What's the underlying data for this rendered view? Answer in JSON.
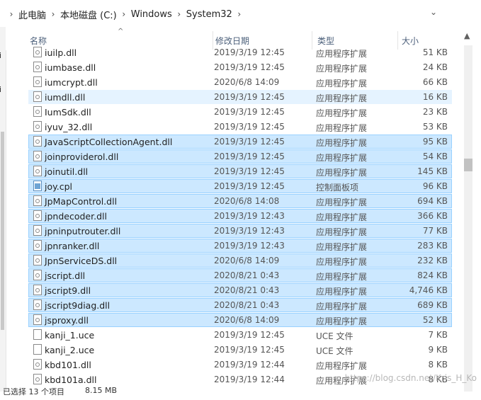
{
  "breadcrumb": {
    "items": [
      "此电脑",
      "本地磁盘 (C:)",
      "Windows",
      "System32"
    ]
  },
  "columns": {
    "name": "名称",
    "date": "修改日期",
    "type": "类型",
    "size": "大小"
  },
  "files": [
    {
      "name": "iuilp.dll",
      "date": "2019/3/19 12:45",
      "type": "应用程序扩展",
      "size": "51 KB",
      "icon": "dll-file-icon",
      "state": "normal"
    },
    {
      "name": "iumbase.dll",
      "date": "2019/3/19 12:45",
      "type": "应用程序扩展",
      "size": "24 KB",
      "icon": "dll-file-icon",
      "state": "normal"
    },
    {
      "name": "iumcrypt.dll",
      "date": "2020/6/8 14:09",
      "type": "应用程序扩展",
      "size": "66 KB",
      "icon": "dll-file-icon",
      "state": "normal"
    },
    {
      "name": "iumdll.dll",
      "date": "2019/3/19 12:45",
      "type": "应用程序扩展",
      "size": "16 KB",
      "icon": "dll-file-icon",
      "state": "hover"
    },
    {
      "name": "IumSdk.dll",
      "date": "2019/3/19 12:45",
      "type": "应用程序扩展",
      "size": "23 KB",
      "icon": "dll-file-icon",
      "state": "normal"
    },
    {
      "name": "iyuv_32.dll",
      "date": "2019/3/19 12:45",
      "type": "应用程序扩展",
      "size": "53 KB",
      "icon": "dll-file-icon",
      "state": "normal"
    },
    {
      "name": "JavaScriptCollectionAgent.dll",
      "date": "2019/3/19 12:45",
      "type": "应用程序扩展",
      "size": "95 KB",
      "icon": "dll-file-icon",
      "state": "selected"
    },
    {
      "name": "joinproviderol.dll",
      "date": "2019/3/19 12:45",
      "type": "应用程序扩展",
      "size": "54 KB",
      "icon": "dll-file-icon",
      "state": "selected"
    },
    {
      "name": "joinutil.dll",
      "date": "2019/3/19 12:45",
      "type": "应用程序扩展",
      "size": "145 KB",
      "icon": "dll-file-icon",
      "state": "selected"
    },
    {
      "name": "joy.cpl",
      "date": "2019/3/19 12:45",
      "type": "控制面板项",
      "size": "96 KB",
      "icon": "control-panel-icon",
      "state": "selected"
    },
    {
      "name": "JpMapControl.dll",
      "date": "2020/6/8 14:08",
      "type": "应用程序扩展",
      "size": "694 KB",
      "icon": "dll-file-icon",
      "state": "selected"
    },
    {
      "name": "jpndecoder.dll",
      "date": "2019/3/19 12:43",
      "type": "应用程序扩展",
      "size": "366 KB",
      "icon": "dll-file-icon",
      "state": "selected"
    },
    {
      "name": "jpninputrouter.dll",
      "date": "2019/3/19 12:43",
      "type": "应用程序扩展",
      "size": "77 KB",
      "icon": "dll-file-icon",
      "state": "selected"
    },
    {
      "name": "jpnranker.dll",
      "date": "2019/3/19 12:43",
      "type": "应用程序扩展",
      "size": "283 KB",
      "icon": "dll-file-icon",
      "state": "selected"
    },
    {
      "name": "JpnServiceDS.dll",
      "date": "2020/6/8 14:09",
      "type": "应用程序扩展",
      "size": "232 KB",
      "icon": "dll-file-icon",
      "state": "selected"
    },
    {
      "name": "jscript.dll",
      "date": "2020/8/21 0:43",
      "type": "应用程序扩展",
      "size": "824 KB",
      "icon": "dll-file-icon",
      "state": "selected"
    },
    {
      "name": "jscript9.dll",
      "date": "2020/8/21 0:43",
      "type": "应用程序扩展",
      "size": "4,746 KB",
      "icon": "dll-file-icon",
      "state": "selected"
    },
    {
      "name": "jscript9diag.dll",
      "date": "2020/8/21 0:43",
      "type": "应用程序扩展",
      "size": "689 KB",
      "icon": "dll-file-icon",
      "state": "selected"
    },
    {
      "name": "jsproxy.dll",
      "date": "2020/6/8 14:09",
      "type": "应用程序扩展",
      "size": "52 KB",
      "icon": "dll-file-icon",
      "state": "selected"
    },
    {
      "name": "kanji_1.uce",
      "date": "2019/3/19 12:45",
      "type": "UCE 文件",
      "size": "7 KB",
      "icon": "file-icon",
      "state": "normal"
    },
    {
      "name": "kanji_2.uce",
      "date": "2019/3/19 12:45",
      "type": "UCE 文件",
      "size": "9 KB",
      "icon": "file-icon",
      "state": "normal"
    },
    {
      "name": "kbd101.dll",
      "date": "2019/3/19 12:44",
      "type": "应用程序扩展",
      "size": "8 KB",
      "icon": "dll-file-icon",
      "state": "normal"
    },
    {
      "name": "kbd101a.dll",
      "date": "2019/3/19 12:44",
      "type": "应用程序扩展",
      "size": "8 KB",
      "icon": "dll-file-icon",
      "state": "normal"
    }
  ],
  "status_bar": {
    "items_text": "已选择 13 个项目",
    "size_text": "8.15 MB"
  },
  "watermark": "https://blog.csdn.net/Kris_H_Ko"
}
